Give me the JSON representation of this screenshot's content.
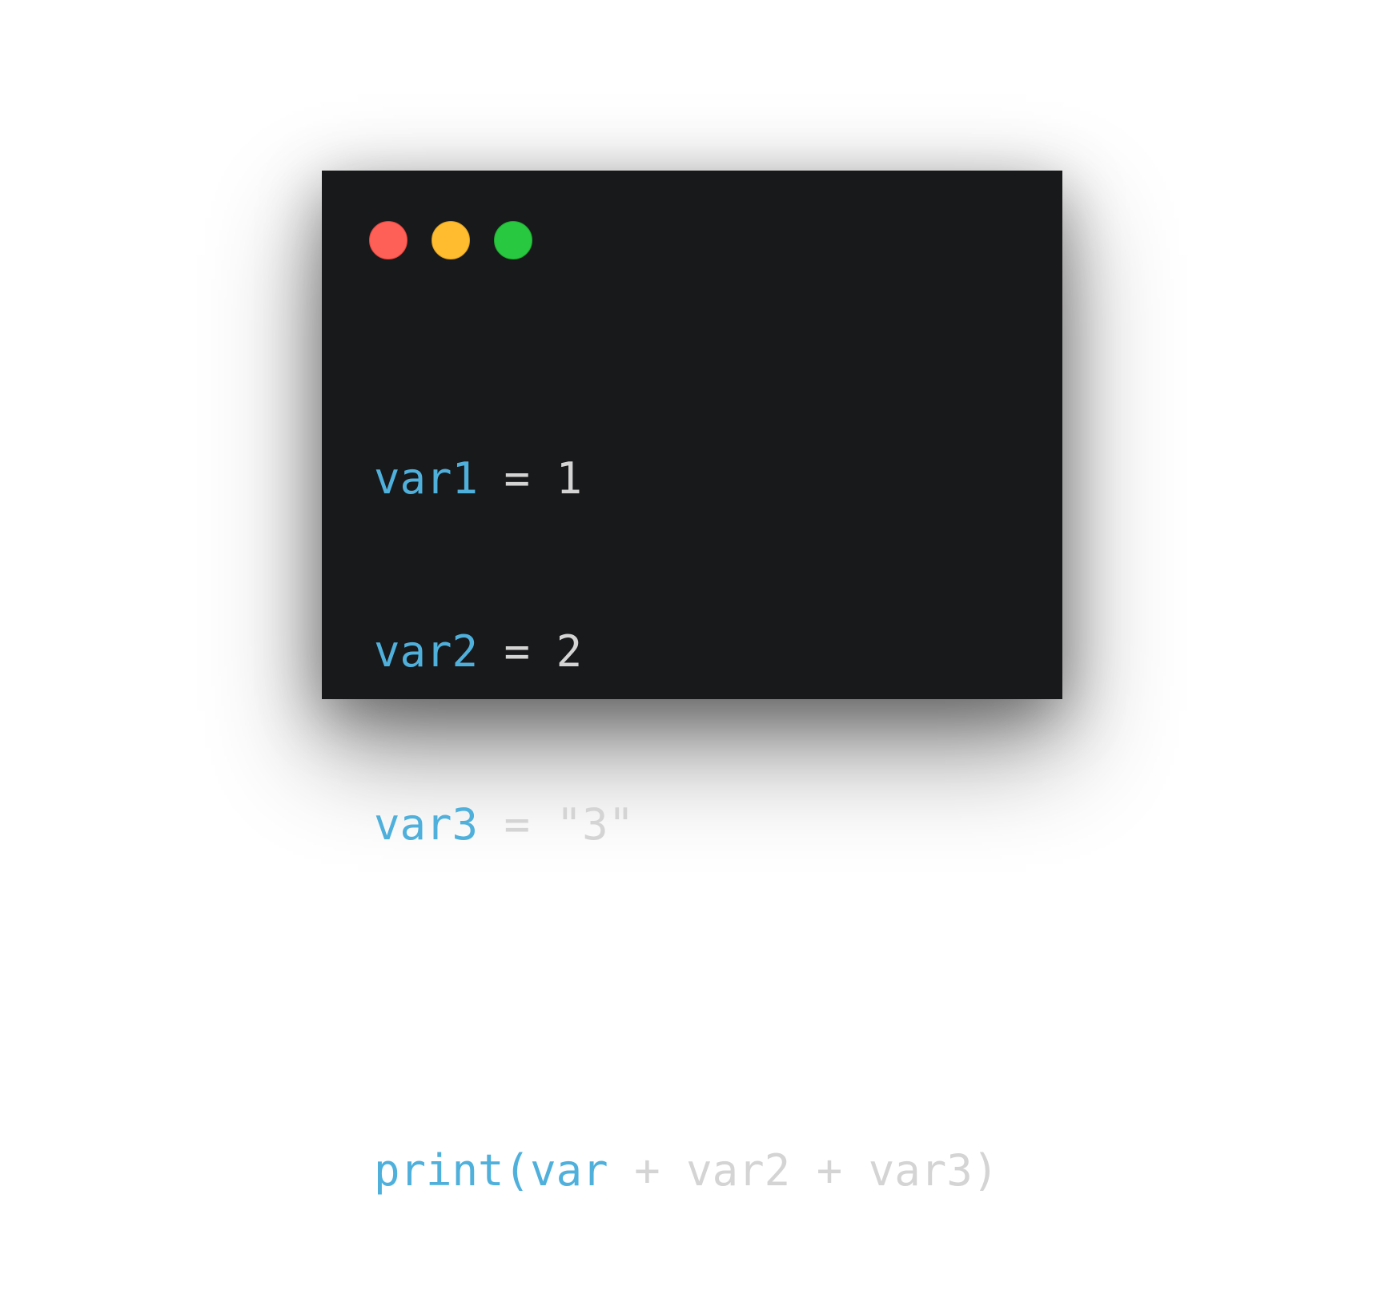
{
  "code": {
    "lines": [
      [
        {
          "text": "var1",
          "kind": "name"
        },
        {
          "text": " = 1",
          "kind": "plain"
        }
      ],
      [
        {
          "text": "var2",
          "kind": "name"
        },
        {
          "text": " = 2",
          "kind": "plain"
        }
      ],
      [
        {
          "text": "var3",
          "kind": "name"
        },
        {
          "text": " = \"3\"",
          "kind": "plain"
        }
      ],
      [],
      [
        {
          "text": "print(var",
          "kind": "name"
        },
        {
          "text": " + var2 + var3)",
          "kind": "plain"
        }
      ]
    ]
  },
  "window": {
    "controls": {
      "close_icon": "red-circle",
      "minimize_icon": "yellow-circle",
      "maximize_icon": "green-circle"
    },
    "colors": {
      "background": "#18191b",
      "name_token": "#4fb0dc",
      "plain_token": "#d4d4d4",
      "close": "#fe5f57",
      "minimize": "#febc2e",
      "maximize": "#28c840"
    }
  }
}
